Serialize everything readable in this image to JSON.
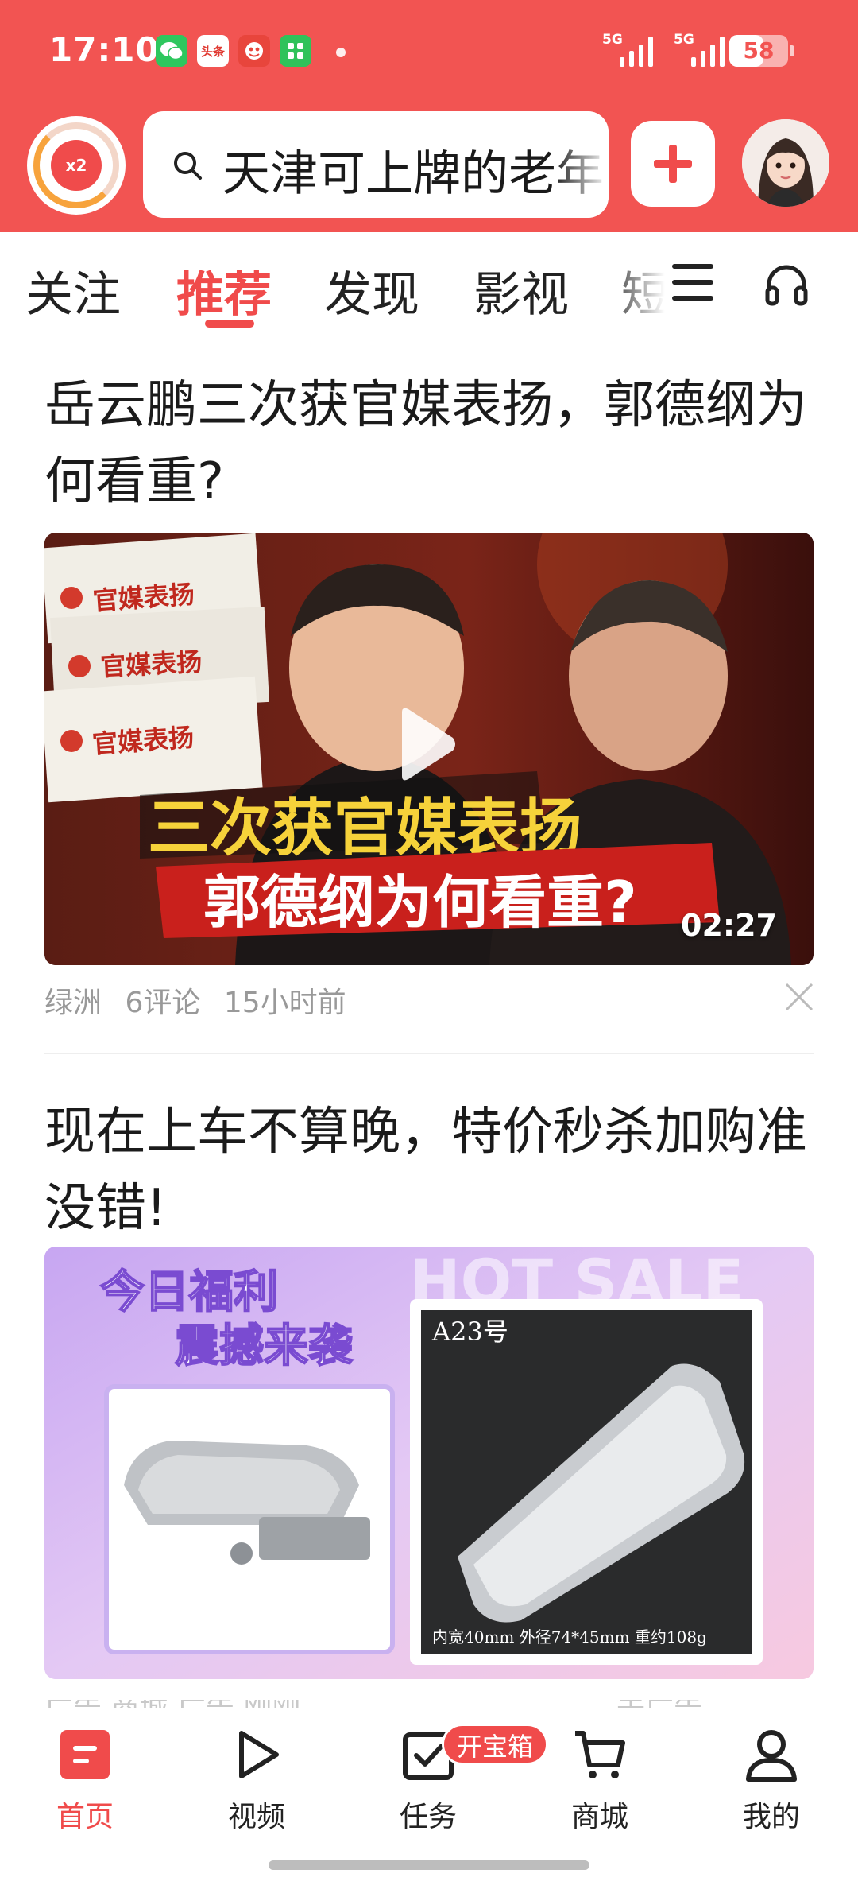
{
  "status_bar": {
    "time": "17:10",
    "app_icons": [
      {
        "name": "wechat-icon",
        "color": "#2ec75e",
        "label": ""
      },
      {
        "name": "toutiao-icon",
        "color": "#ffffff",
        "label": "头条"
      },
      {
        "name": "game-app-icon",
        "color": "#e8453c",
        "label": ""
      },
      {
        "name": "mini-app-icon",
        "color": "#30c25a",
        "label": ""
      }
    ],
    "signal_1_label": "5G",
    "signal_2_label": "5G",
    "battery_level": "58"
  },
  "header": {
    "reward_badge": "x2",
    "search_text": "天津可上牌的老年",
    "add_icon": "plus-icon",
    "profile_icon": "avatar"
  },
  "tabs": {
    "items": [
      "关注",
      "推荐",
      "发现",
      "影视",
      "短"
    ],
    "active": "推荐"
  },
  "feed": [
    {
      "title": "岳云鹏三次获官媒表扬，郭德纲为何看重?",
      "thumbnail": {
        "stamps": [
          "官媒表扬",
          "官媒表扬",
          "官媒表扬"
        ],
        "headline_top": "三次获官媒表扬",
        "headline_bottom": "郭德纲为何看重?",
        "duration": "02:27"
      },
      "source": "绿洲",
      "comments": "6评论",
      "time": "15小时前"
    },
    {
      "title": "现在上车不算晚，特价秒杀加购准没错!",
      "banner": {
        "headline_1": "今日福利",
        "headline_2": "震撼来袭",
        "watermark": "HOT SALE",
        "model": "A23号",
        "spec": "内宽40mm 外径74*45mm 重约108g"
      },
      "meta_peek": "广告 商城 广告 刚刚",
      "meta_peek_right": "去广告"
    }
  ],
  "bottom_nav": [
    {
      "label": "首页",
      "icon": "home-icon",
      "active": true
    },
    {
      "label": "视频",
      "icon": "play-icon",
      "active": false
    },
    {
      "label": "任务",
      "icon": "task-icon",
      "active": false,
      "badge": "开宝箱"
    },
    {
      "label": "商城",
      "icon": "cart-icon",
      "active": false
    },
    {
      "label": "我的",
      "icon": "profile-icon",
      "active": false
    }
  ],
  "colors": {
    "brand_red": "#f25452",
    "accent_red": "#f04b4b",
    "meta_gray": "#999999"
  }
}
